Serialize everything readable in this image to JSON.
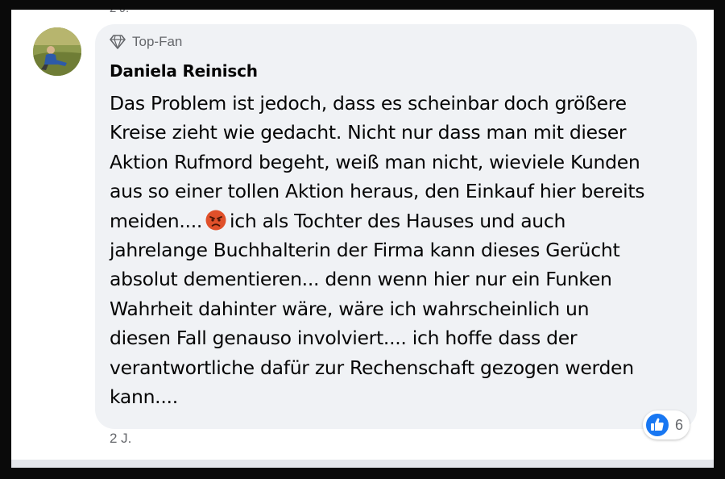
{
  "comment": {
    "author": "Daniela Reinisch",
    "badge_label": "Top-Fan",
    "badge_icon": "diamond-icon",
    "text_lines": [
      "Das Problem ist jedoch, dass es scheinbar doch größere",
      "Kreise zieht wie gedacht. Nicht nur dass man mit dieser",
      "Aktion Rufmord begeht, weiß man nicht, wieviele Kunden",
      "aus so einer tollen Aktion heraus, den Einkauf hier bereits"
    ],
    "line5_before_emoji": "meiden....",
    "emoji": "angry-face-emoji",
    "line5_after_emoji": "ich als Tochter des Hauses und auch",
    "text_lines_rest": [
      "jahrelange Buchhalterin der Firma kann dieses Gerücht",
      "absolut dementieren... denn wenn hier nur ein Funken",
      "Wahrheit dahinter wäre, wäre ich wahrscheinlich un",
      "diesen Fall genauso involviert.... ich hoffe dass der",
      "verantwortliche dafür zur Rechenschaft gezogen werden",
      "kann...."
    ],
    "timestamp": "2 J.",
    "reaction_icon": "like-icon",
    "reaction_count": "6"
  },
  "colors": {
    "bubble_bg": "#f0f2f5",
    "secondary_text": "#65676b",
    "like_blue": "#1877f2"
  }
}
